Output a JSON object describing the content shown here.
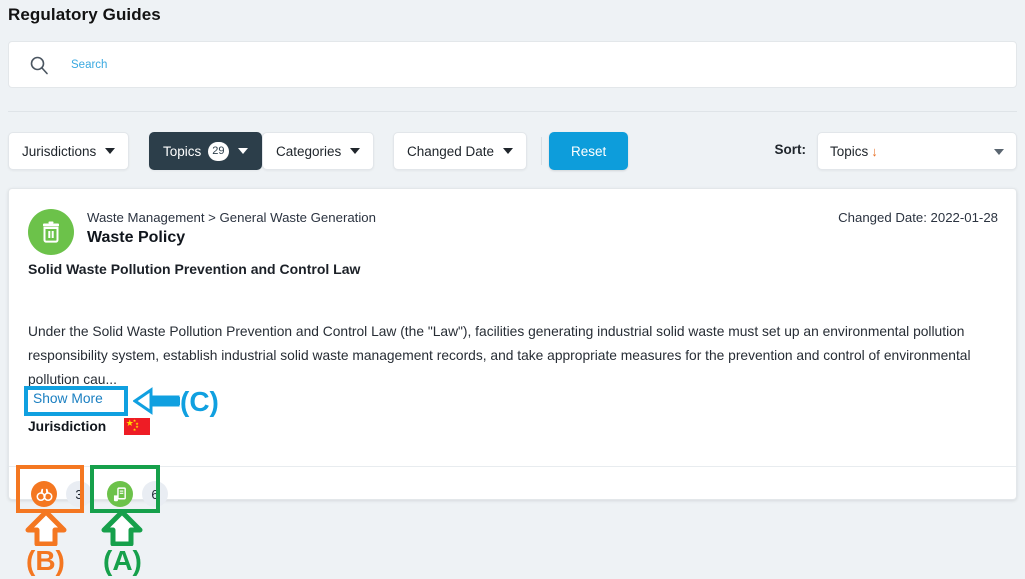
{
  "header": {
    "title": "Regulatory Guides"
  },
  "search": {
    "icon": "search-icon",
    "placeholder": "Search",
    "value": ""
  },
  "toolbar": {
    "filters": [
      {
        "id": "jurisdictions",
        "label": "Jurisdictions",
        "count": null,
        "active": false
      },
      {
        "id": "topics",
        "label": "Topics",
        "count": "29",
        "active": true
      },
      {
        "id": "categories",
        "label": "Categories",
        "count": null,
        "active": false
      },
      {
        "id": "changed-date",
        "label": "Changed Date",
        "count": null,
        "active": false
      }
    ],
    "reset_label": "Reset",
    "sort_label": "Sort:",
    "sort_value": "Topics",
    "sort_direction": "↓",
    "reset_color": "#0d9ddb",
    "active_filter_color": "#2c3e4a"
  },
  "result": {
    "icon": "trash-bin-icon",
    "icon_color": "#6cc24a",
    "breadcrumb": "Waste Management > General Waste Generation",
    "title": "Waste Policy",
    "changed_date": "Changed Date: 2022-01-28",
    "law_name": "Solid Waste Pollution Prevention and Control Law",
    "body": "Under the Solid Waste Pollution Prevention and Control Law (the \"Law\"), facilities generating industrial solid waste must set up an environmental pollution responsibility system, establish industrial solid waste management records, and take appropriate measures for the prevention and control of environmental pollution cau...",
    "show_more_label": "Show More",
    "jurisdiction_label": "Jurisdiction",
    "jurisdiction_flag": "china-flag",
    "badges": [
      {
        "id": "monitoring",
        "icon": "binoculars-icon",
        "icon_color": "#f47721",
        "count": "3"
      },
      {
        "id": "documents",
        "icon": "legal-document-icon",
        "icon_color": "#6cc24a",
        "count": "6"
      }
    ]
  },
  "annotations": [
    {
      "id": "c",
      "label": "(C)",
      "color": "#10a0e0",
      "target": "show-more-link"
    },
    {
      "id": "b",
      "label": "(B)",
      "color": "#f47721",
      "target": "badge-monitoring"
    },
    {
      "id": "a",
      "label": "(A)",
      "color": "#16a04b",
      "target": "badge-documents"
    }
  ]
}
